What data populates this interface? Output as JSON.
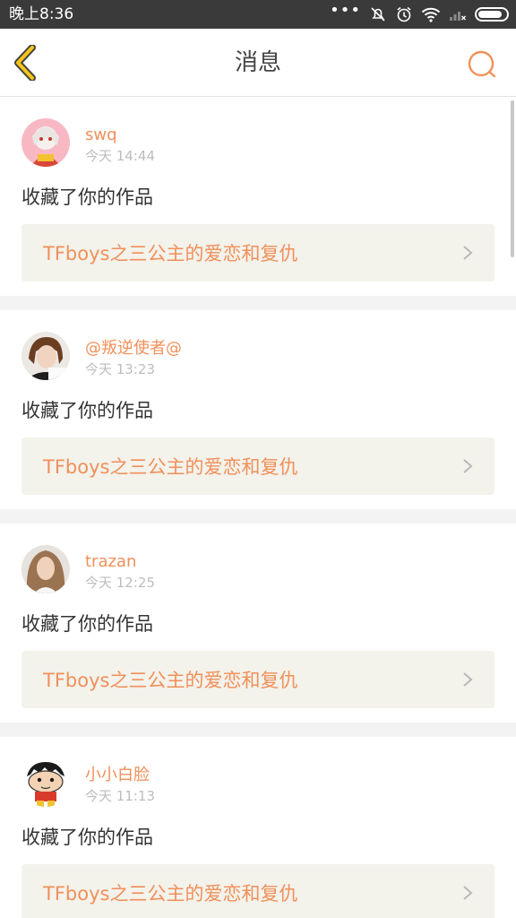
{
  "status_bar": {
    "time": "晚上8:36"
  },
  "header": {
    "title": "消息"
  },
  "colors": {
    "accent": "#f0905a",
    "back_arrow": "#f5c518",
    "card_bg": "#f3f2eb"
  },
  "messages": [
    {
      "username": "swq",
      "time": "今天 14:44",
      "action": "收藏了你的作品",
      "work_title": "TFboys之三公主的爱恋和复仇"
    },
    {
      "username": "@叛逆使者@",
      "time": "今天 13:23",
      "action": "收藏了你的作品",
      "work_title": "TFboys之三公主的爱恋和复仇"
    },
    {
      "username": "trazan",
      "time": "今天 12:25",
      "action": "收藏了你的作品",
      "work_title": "TFboys之三公主的爱恋和复仇"
    },
    {
      "username": "小小白脸",
      "time": "今天 11:13",
      "action": "收藏了你的作品",
      "work_title": "TFboys之三公主的爱恋和复仇"
    }
  ]
}
